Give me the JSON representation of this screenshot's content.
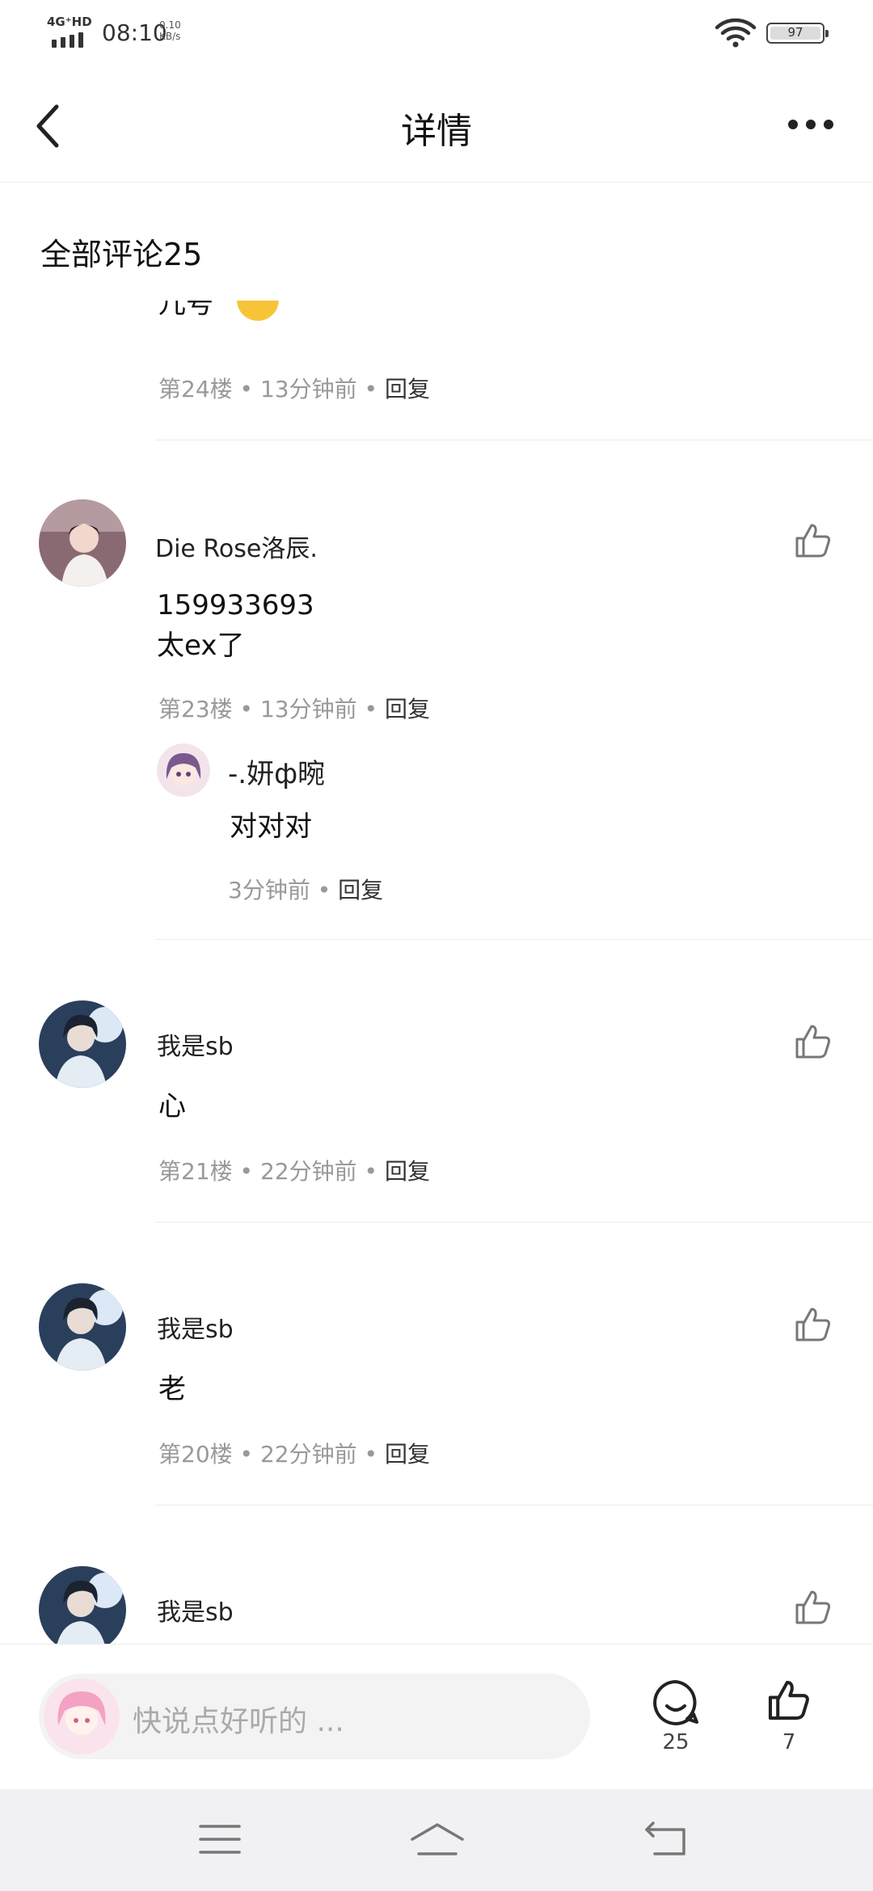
{
  "status_bar": {
    "network": "4G⁺HD",
    "time": "08:10",
    "speed_value": "0.10",
    "speed_unit": "KB/s",
    "battery": "97"
  },
  "nav": {
    "title": "详情",
    "back_icon": "chevron-left-icon",
    "more_icon": "more-dots-icon"
  },
  "section_title": "全部评论25",
  "comments": [
    {
      "text": "儿号",
      "floor": "第24楼",
      "time": "13分钟前",
      "reply": "回复"
    },
    {
      "username": "Die Rose洛辰.",
      "text_line1": "159933693",
      "text_line2": "太ex了",
      "floor": "第23楼",
      "time": "13分钟前",
      "reply": "回复",
      "sub_reply": {
        "username": "-.妍ф晼",
        "text": "对对对",
        "time": "3分钟前",
        "reply": "回复"
      }
    },
    {
      "username": "我是sb",
      "text": "心",
      "floor": "第21楼",
      "time": "22分钟前",
      "reply": "回复"
    },
    {
      "username": "我是sb",
      "text": "老",
      "floor": "第20楼",
      "time": "22分钟前",
      "reply": "回复"
    },
    {
      "username": "我是sb"
    }
  ],
  "bottom_bar": {
    "input_placeholder": "快说点好听的 ...",
    "comment_count": "25",
    "like_count": "7"
  },
  "colors": {
    "meta_gray": "#999999",
    "divider": "#ececec",
    "system_nav_bg": "#f1f1f3"
  }
}
